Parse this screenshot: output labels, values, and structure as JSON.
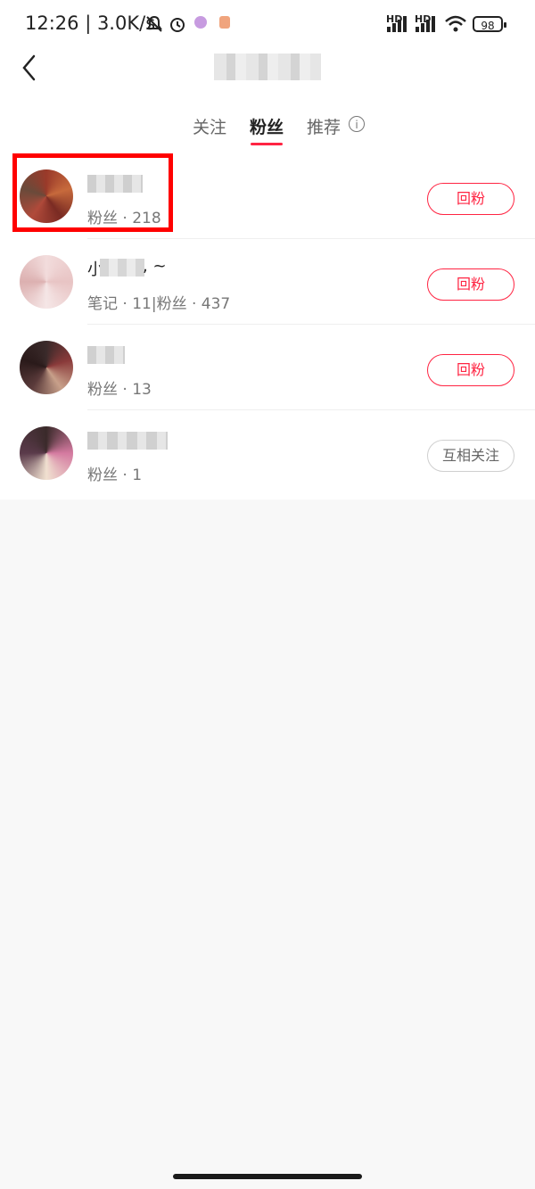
{
  "status_bar": {
    "time": "12:26 | 3.0K/s",
    "hd1": "HD",
    "hd2": "HD",
    "battery": "98"
  },
  "tabs": [
    {
      "label": "关注"
    },
    {
      "label": "粉丝"
    },
    {
      "label": "推荐"
    }
  ],
  "info_icon_glyph": "i",
  "followers": [
    {
      "meta": "粉丝 · 218",
      "button": "回粉"
    },
    {
      "name_prefix": "小",
      "name_suffix": ", ~",
      "meta": "笔记 · 11|粉丝 · 437",
      "button": "回粉"
    },
    {
      "meta": "粉丝 · 13",
      "button": "回粉"
    },
    {
      "meta": "粉丝 · 1",
      "button": "互相关注"
    }
  ],
  "accent_color": "#ff2442"
}
